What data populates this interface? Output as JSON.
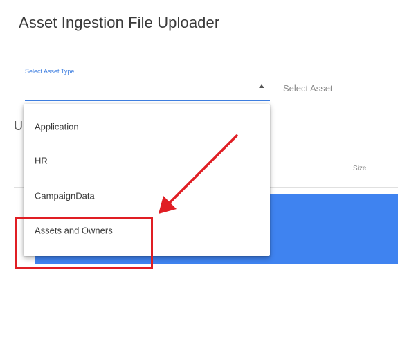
{
  "page": {
    "title": "Asset Ingestion File Uploader"
  },
  "form": {
    "asset_type_label": "Select Asset Type",
    "asset_placeholder": "Select Asset"
  },
  "background": {
    "upload_heading_visible": "U",
    "size_header": "Size"
  },
  "dropdown": {
    "items": [
      {
        "label": "Application"
      },
      {
        "label": "HR"
      },
      {
        "label": "CampaignData"
      },
      {
        "label": "Assets and Owners"
      }
    ],
    "highlighted_item": "Assets and Owners"
  },
  "annotation": {
    "highlight_color": "#e01e24",
    "arrow_color": "#e01e24"
  },
  "colors": {
    "accent": "#3f7fe0",
    "drop_zone": "#3f83f0"
  }
}
